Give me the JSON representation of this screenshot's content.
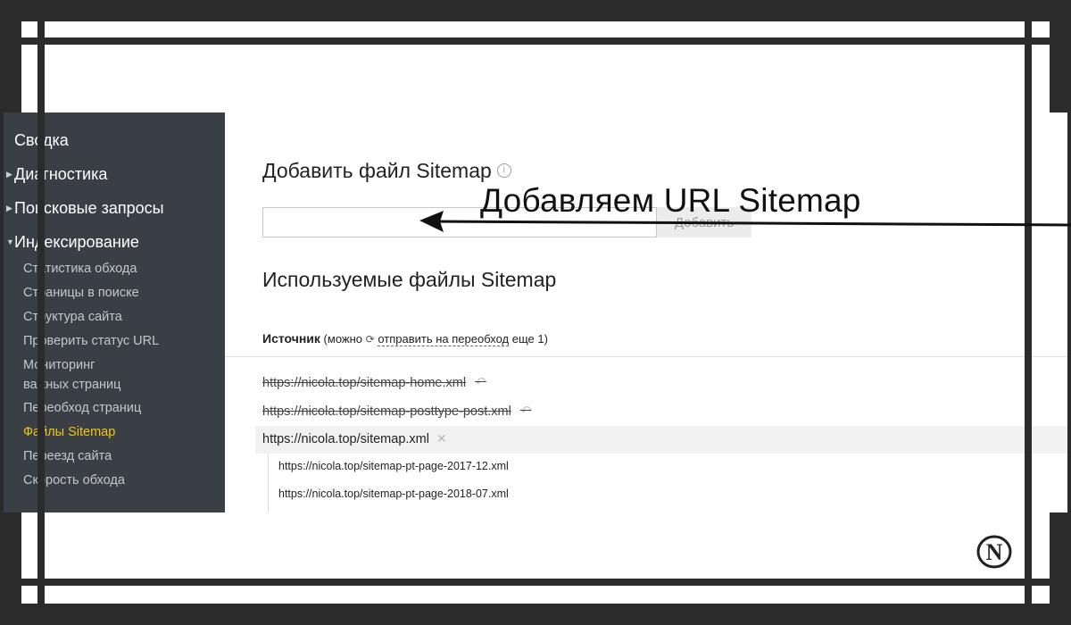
{
  "sidebar": {
    "main_items": [
      {
        "label": "Сводка",
        "has_arrow": false
      },
      {
        "label": "Диагностика",
        "has_arrow": true
      },
      {
        "label": "Поисковые запросы",
        "has_arrow": true
      },
      {
        "label": "Индексирование",
        "has_arrow": true,
        "expanded": true
      }
    ],
    "sub_items": [
      {
        "label": "Статистика обхода"
      },
      {
        "label": "Страницы в поиске"
      },
      {
        "label": "Структура сайта"
      },
      {
        "label": "Проверить статус URL"
      },
      {
        "label": "Мониторинг",
        "label2": "важных страниц"
      },
      {
        "label": "Переобход страниц"
      },
      {
        "label": "Файлы Sitemap",
        "active": true
      },
      {
        "label": "Переезд сайта"
      },
      {
        "label": "Скорость обхода"
      }
    ]
  },
  "main": {
    "add_title": "Добавить файл Sitemap",
    "info_icon": "i",
    "url_input": {
      "value": "",
      "placeholder": ""
    },
    "add_button": "Добавить",
    "used_title": "Используемые файлы Sitemap",
    "source_label": "Источник",
    "source_note_prefix": "(можно",
    "resend_link": "отправить на переобход",
    "source_note_suffix": "еще 1)",
    "sitemaps": [
      {
        "url": "https://nicola.top/sitemap-home.xml",
        "state": "deleted",
        "icon": "undo-icon"
      },
      {
        "url": "https://nicola.top/sitemap-posttype-post.xml",
        "state": "deleted",
        "icon": "undo-icon"
      },
      {
        "url": "https://nicola.top/sitemap.xml",
        "state": "active",
        "icon": "remove-icon"
      }
    ],
    "child_sitemaps": [
      "https://nicola.top/sitemap-pt-page-2017-12.xml",
      "https://nicola.top/sitemap-pt-page-2018-07.xml"
    ]
  },
  "annotation": {
    "text": "Добавляем URL Sitemap",
    "icon": "arrow-left-icon"
  },
  "logo": {
    "letter": "N",
    "icon": "nicola-logo"
  },
  "colors": {
    "sidebar_bg": "#3a3f45",
    "active_item": "#f2c511",
    "frame": "#2b2b2b"
  }
}
